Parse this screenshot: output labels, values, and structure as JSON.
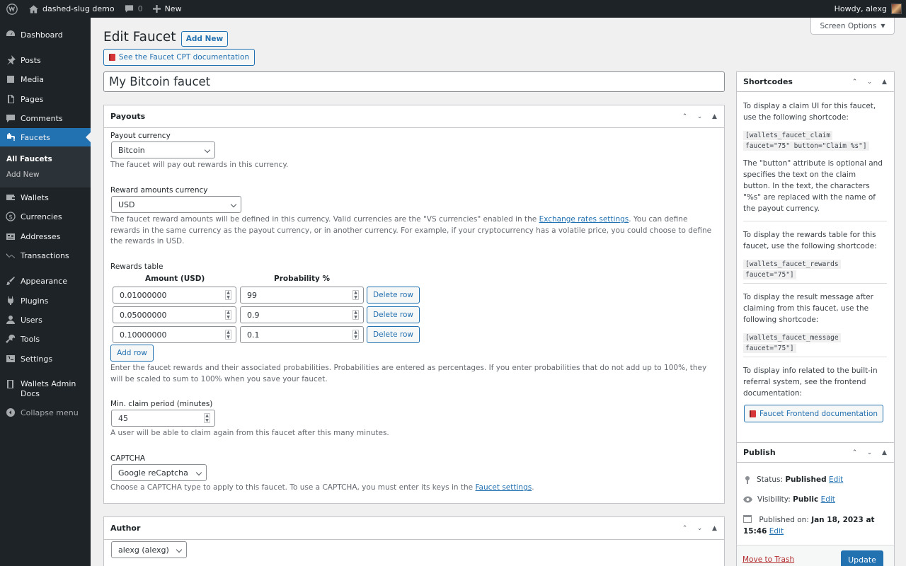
{
  "admin_bar": {
    "site_name": "dashed-slug demo",
    "comments_count": "0",
    "new_label": "New",
    "greeting": "Howdy, alexg"
  },
  "sidebar": {
    "items": [
      {
        "label": "Dashboard",
        "icon": "dashboard-icon"
      },
      {
        "label": "Posts",
        "icon": "pin-icon"
      },
      {
        "label": "Media",
        "icon": "media-icon"
      },
      {
        "label": "Pages",
        "icon": "page-icon"
      },
      {
        "label": "Comments",
        "icon": "comment-icon"
      },
      {
        "label": "Faucets",
        "icon": "faucet-icon"
      },
      {
        "label": "Wallets",
        "icon": "wallet-icon"
      },
      {
        "label": "Currencies",
        "icon": "dollar-icon"
      },
      {
        "label": "Addresses",
        "icon": "address-card-icon"
      },
      {
        "label": "Transactions",
        "icon": "transactions-icon"
      },
      {
        "label": "Appearance",
        "icon": "brush-icon"
      },
      {
        "label": "Plugins",
        "icon": "plug-icon"
      },
      {
        "label": "Users",
        "icon": "user-icon"
      },
      {
        "label": "Tools",
        "icon": "wrench-icon"
      },
      {
        "label": "Settings",
        "icon": "settings-icon"
      },
      {
        "label": "Wallets Admin Docs",
        "icon": "book-icon"
      },
      {
        "label": "Collapse menu",
        "icon": "collapse-icon"
      }
    ],
    "submenu": [
      "All Faucets",
      "Add New"
    ]
  },
  "header": {
    "title": "Edit Faucet",
    "add_new": "Add New",
    "doc_button": "See the Faucet CPT documentation",
    "screen_options": "Screen Options"
  },
  "post_title": "My Bitcoin faucet",
  "payouts": {
    "heading": "Payouts",
    "payout_currency_label": "Payout currency",
    "payout_currency_value": "Bitcoin",
    "payout_currency_desc": "The faucet will pay out rewards in this currency.",
    "reward_currency_label": "Reward amounts currency",
    "reward_currency_value": "USD",
    "reward_desc_1": "The faucet reward amounts will be defined in this currency. Valid currencies are the \"VS currencies\" enabled in the ",
    "reward_desc_link": "Exchange rates settings",
    "reward_desc_2": ". You can define rewards in the same currency as the payout currency, or in another currency. For example, if your cryptocurrency has a volatile price, you could choose to define the rewards in USD.",
    "rewards_table_label": "Rewards table",
    "col_amount": "Amount (USD)",
    "col_probability": "Probability %",
    "rows": [
      {
        "amount": "0.01000000",
        "probability": "99"
      },
      {
        "amount": "0.05000000",
        "probability": "0.9"
      },
      {
        "amount": "0.10000000",
        "probability": "0.1"
      }
    ],
    "delete_row": "Delete row",
    "add_row": "Add row",
    "rewards_desc": "Enter the faucet rewards and their associated probabilities. Probabilities are entered as percentages. If you enter probabilities that do not add up to 100%, they will be scaled to sum to 100% when you save your faucet.",
    "claim_label": "Min. claim period (minutes)",
    "claim_value": "45",
    "claim_desc": "A user will be able to claim again from this faucet after this many minutes.",
    "captcha_label": "CAPTCHA",
    "captcha_value": "Google reCaptcha",
    "captcha_desc": "Choose a CAPTCHA type to apply to this faucet. To use a CAPTCHA, you must enter its keys in the ",
    "captcha_link": "Faucet settings",
    "captcha_desc_end": "."
  },
  "author": {
    "heading": "Author",
    "value": "alexg (alexg)"
  },
  "shortcodes": {
    "heading": "Shortcodes",
    "claim_text": "To display a claim UI for this faucet, use the following shortcode:",
    "claim_code_1": "[wallets_faucet_claim",
    "claim_code_2": "faucet=\"75\" button=\"Claim %s\"]",
    "button_text": "The \"button\" attribute is optional and specifies the text on the claim button. In the text, the characters \"%s\" are replaced with the name of the payout currency.",
    "rewards_text": "To display the rewards table for this faucet, use the following shortcode:",
    "rewards_code_1": "[wallets_faucet_rewards",
    "rewards_code_2": "faucet=\"75\"]",
    "message_text": "To display the result message after claiming from this faucet, use the following shortcode:",
    "message_code_1": "[wallets_faucet_message",
    "message_code_2": "faucet=\"75\"]",
    "referral_text": "To display info related to the built-in referral system, see the frontend documentation:",
    "frontend_doc": "Faucet Frontend documentation"
  },
  "publish": {
    "heading": "Publish",
    "status_label": "Status: ",
    "status_value": "Published",
    "visibility_label": "Visibility: ",
    "visibility_value": "Public",
    "published_label": "Published on: ",
    "published_value_1": "Jan 18, 2023 at",
    "published_value_2": "15:46",
    "edit": "Edit",
    "trash": "Move to Trash",
    "update": "Update"
  }
}
